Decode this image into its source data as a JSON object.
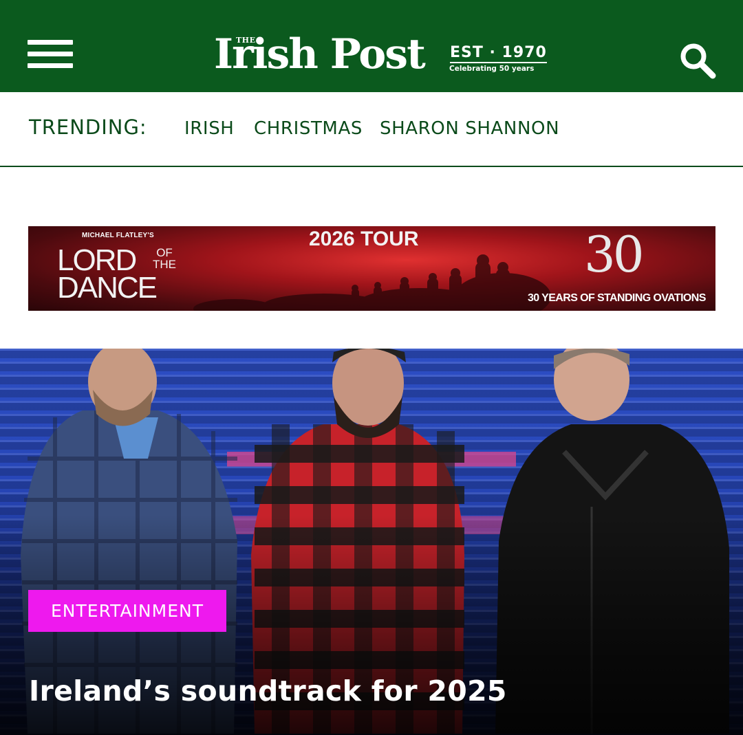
{
  "header": {
    "menu_icon": "hamburger-menu-icon",
    "logo": {
      "the": "THE",
      "name": "Irish Post",
      "est": "EST · 1970",
      "celebrating": "Celebrating 50 years"
    },
    "search_icon": "search-icon",
    "background_color": "#0b5a1e"
  },
  "trending": {
    "label": "TRENDING:",
    "links": [
      "IRISH",
      "CHRISTMAS",
      "SHARON SHANNON"
    ],
    "text_color": "#0b4a1a"
  },
  "ad": {
    "presenter": "MICHAEL FLATLEY'S",
    "title_lord": "LORD",
    "title_of": "OF",
    "title_the": "THE",
    "title_dance": "DANCE",
    "tour": "2026 TOUR",
    "anniversary": "30",
    "tagline": "30 YEARS OF STANDING OVATIONS"
  },
  "hero": {
    "category": "ENTERTAINMENT",
    "category_color": "#ee19ee",
    "headline": "Ireland’s soundtrack for 2025"
  }
}
